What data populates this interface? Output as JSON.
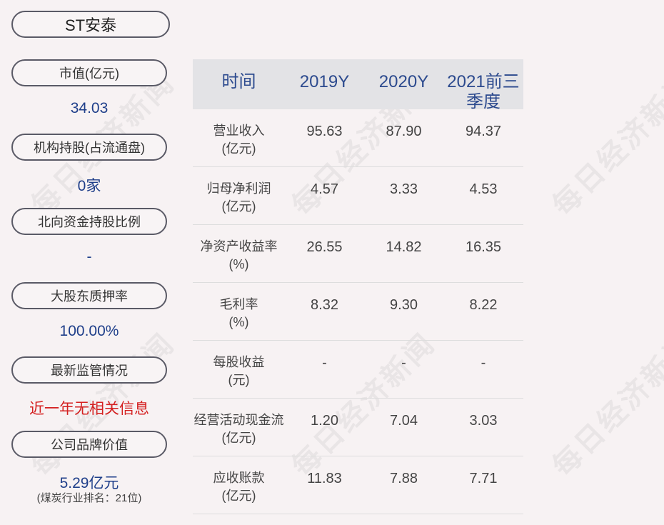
{
  "company": "ST安泰",
  "metrics": [
    {
      "label": "市值(亿元)",
      "value": "34.03"
    },
    {
      "label": "机构持股(占流通盘)",
      "value": "0家"
    },
    {
      "label": "北向资金持股比例",
      "value": "-"
    },
    {
      "label": "大股东质押率",
      "value": "100.00%"
    },
    {
      "label": "最新监管情况",
      "value": "近一年无相关信息"
    },
    {
      "label": "公司品牌价值",
      "value": "5.29亿元",
      "note": "(煤炭行业排名：21位)"
    }
  ],
  "table": {
    "headers": [
      "时间",
      "2019Y",
      "2020Y",
      "2021前三季度"
    ],
    "rows": [
      {
        "name": "营业收入",
        "unit": "(亿元)",
        "values": [
          "95.63",
          "87.90",
          "94.37"
        ]
      },
      {
        "name": "归母净利润",
        "unit": "(亿元)",
        "values": [
          "4.57",
          "3.33",
          "4.53"
        ]
      },
      {
        "name": "净资产收益率",
        "unit": "(%)",
        "values": [
          "26.55",
          "14.82",
          "16.35"
        ]
      },
      {
        "name": "毛利率",
        "unit": "(%)",
        "values": [
          "8.32",
          "9.30",
          "8.22"
        ]
      },
      {
        "name": "每股收益",
        "unit": "(元)",
        "values": [
          "-",
          "-",
          "-"
        ]
      },
      {
        "name": "经营活动现金流",
        "unit": "(亿元)",
        "values": [
          "1.20",
          "7.04",
          "3.03"
        ]
      },
      {
        "name": "应收账款",
        "unit": "(亿元)",
        "values": [
          "11.83",
          "7.88",
          "7.71"
        ]
      }
    ]
  },
  "watermark": "每日经济新闻",
  "colors": {
    "background": "#f7f2f3",
    "value_blue": "#1f3f8a",
    "alert_red": "#d42020",
    "header_bg": "#e3e3e6",
    "header_text": "#2c4a8e"
  }
}
